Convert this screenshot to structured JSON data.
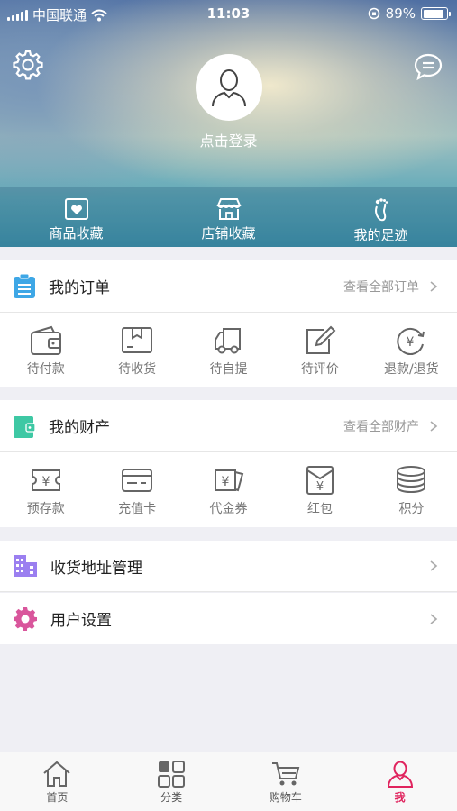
{
  "status_bar": {
    "carrier": "中国联通",
    "time": "11:03",
    "battery": "89%",
    "battery_level": 0.89
  },
  "header": {
    "login_text": "点击登录",
    "favorites": [
      {
        "label": "商品收藏",
        "icon": "heart-box-icon"
      },
      {
        "label": "店铺收藏",
        "icon": "store-icon"
      },
      {
        "label": "我的足迹",
        "icon": "footprint-icon"
      }
    ]
  },
  "orders": {
    "title": "我的订单",
    "more": "查看全部订单",
    "items": [
      {
        "label": "待付款",
        "icon": "wallet-icon"
      },
      {
        "label": "待收货",
        "icon": "package-icon"
      },
      {
        "label": "待自提",
        "icon": "truck-icon"
      },
      {
        "label": "待评价",
        "icon": "edit-icon"
      },
      {
        "label": "退款/退货",
        "icon": "refund-icon"
      }
    ]
  },
  "assets": {
    "title": "我的财产",
    "more": "查看全部财产",
    "items": [
      {
        "label": "预存款",
        "icon": "ticket-yen-icon"
      },
      {
        "label": "充值卡",
        "icon": "card-icon"
      },
      {
        "label": "代金券",
        "icon": "voucher-icon"
      },
      {
        "label": "红包",
        "icon": "red-envelope-icon"
      },
      {
        "label": "积分",
        "icon": "coins-icon"
      }
    ]
  },
  "menu": {
    "address": "收货地址管理",
    "settings": "用户设置"
  },
  "tabbar": {
    "items": [
      {
        "label": "首页",
        "icon": "home-icon"
      },
      {
        "label": "分类",
        "icon": "grid-icon"
      },
      {
        "label": "购物车",
        "icon": "cart-icon"
      },
      {
        "label": "我",
        "icon": "user-icon"
      }
    ],
    "active_color": "#e0245e"
  },
  "colors": {
    "orders_accent": "#3ea7e6",
    "assets_accent": "#3ec8a4",
    "address_accent": "#9b7ff0",
    "settings_accent": "#d9569c"
  }
}
